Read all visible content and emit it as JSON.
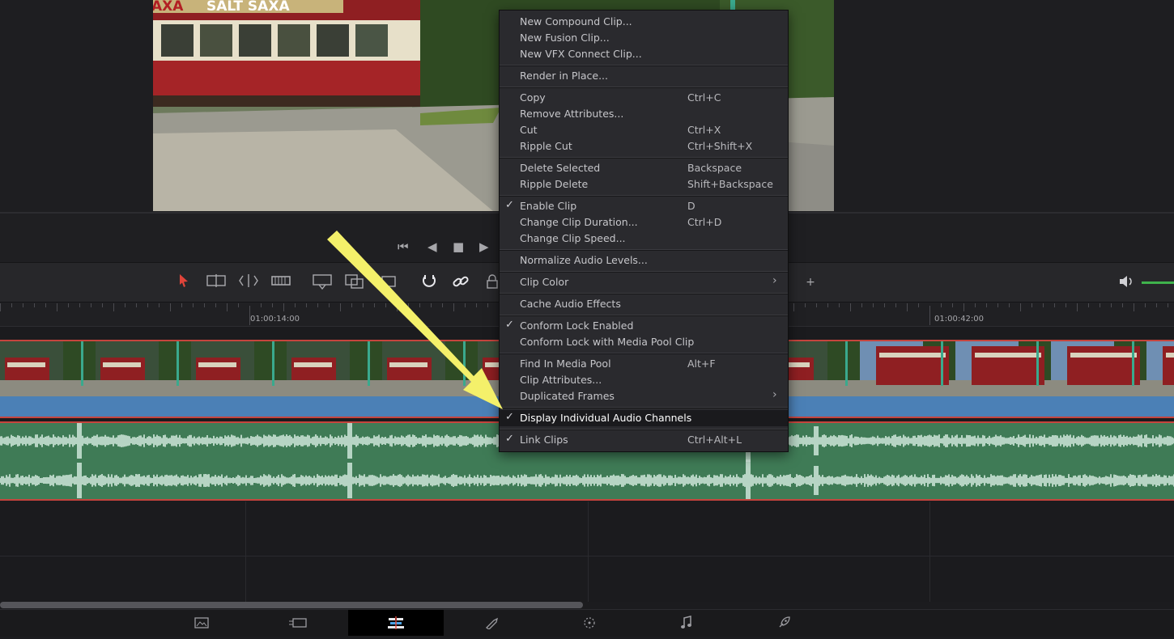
{
  "viewer": {
    "video_sign_text": "SALT SAXA",
    "video_sign_left": "AXA"
  },
  "transport": {
    "icons": [
      "skip-to-start-icon",
      "play-reverse-icon",
      "stop-icon",
      "play-icon"
    ],
    "glyphs": [
      "⏮",
      "◀",
      "■",
      "▶"
    ]
  },
  "ruler": {
    "timecodes": [
      "01:00:14:00",
      "01:00:42:00"
    ]
  },
  "toolbar": {
    "glyph_plus": "+"
  },
  "context_menu": {
    "groups": [
      [
        {
          "label": "New Compound Clip...",
          "shortcut": "",
          "checked": false,
          "submenu": false
        },
        {
          "label": "New Fusion Clip...",
          "shortcut": "",
          "checked": false,
          "submenu": false
        },
        {
          "label": "New VFX Connect Clip...",
          "shortcut": "",
          "checked": false,
          "submenu": false
        }
      ],
      [
        {
          "label": "Render in Place...",
          "shortcut": "",
          "checked": false,
          "submenu": false
        }
      ],
      [
        {
          "label": "Copy",
          "shortcut": "Ctrl+C",
          "checked": false,
          "submenu": false
        },
        {
          "label": "Remove Attributes...",
          "shortcut": "",
          "checked": false,
          "submenu": false
        },
        {
          "label": "Cut",
          "shortcut": "Ctrl+X",
          "checked": false,
          "submenu": false
        },
        {
          "label": "Ripple Cut",
          "shortcut": "Ctrl+Shift+X",
          "checked": false,
          "submenu": false
        }
      ],
      [
        {
          "label": "Delete Selected",
          "shortcut": "Backspace",
          "checked": false,
          "submenu": false
        },
        {
          "label": "Ripple Delete",
          "shortcut": "Shift+Backspace",
          "checked": false,
          "submenu": false
        }
      ],
      [
        {
          "label": "Enable Clip",
          "shortcut": "D",
          "checked": true,
          "submenu": false
        },
        {
          "label": "Change Clip Duration...",
          "shortcut": "Ctrl+D",
          "checked": false,
          "submenu": false
        },
        {
          "label": "Change Clip Speed...",
          "shortcut": "",
          "checked": false,
          "submenu": false
        }
      ],
      [
        {
          "label": "Normalize Audio Levels...",
          "shortcut": "",
          "checked": false,
          "submenu": false
        }
      ],
      [
        {
          "label": "Clip Color",
          "shortcut": "",
          "checked": false,
          "submenu": true
        }
      ],
      [
        {
          "label": "Cache Audio Effects",
          "shortcut": "",
          "checked": false,
          "submenu": false
        }
      ],
      [
        {
          "label": "Conform Lock Enabled",
          "shortcut": "",
          "checked": true,
          "submenu": false
        },
        {
          "label": "Conform Lock with Media Pool Clip",
          "shortcut": "",
          "checked": false,
          "submenu": false
        }
      ],
      [
        {
          "label": "Find In Media Pool",
          "shortcut": "Alt+F",
          "checked": false,
          "submenu": false
        },
        {
          "label": "Clip Attributes...",
          "shortcut": "",
          "checked": false,
          "submenu": false
        },
        {
          "label": "Duplicated Frames",
          "shortcut": "",
          "checked": false,
          "submenu": true
        }
      ],
      [
        {
          "label": "Display Individual Audio Channels",
          "shortcut": "",
          "checked": true,
          "submenu": false,
          "highlighted": true
        }
      ],
      [
        {
          "label": "Link Clips",
          "shortcut": "Ctrl+Alt+L",
          "checked": true,
          "submenu": false
        }
      ]
    ],
    "check_glyph": "✓",
    "submenu_glyph": "›"
  },
  "page_bar": {
    "pages": [
      {
        "name": "media-page",
        "icon": "image-icon",
        "active": false
      },
      {
        "name": "cut-page",
        "icon": "cut-icon",
        "active": false
      },
      {
        "name": "edit-page",
        "icon": "timeline-icon",
        "active": true
      },
      {
        "name": "fusion-page",
        "icon": "fusion-icon",
        "active": false
      },
      {
        "name": "color-page",
        "icon": "color-wheel-icon",
        "active": false
      },
      {
        "name": "fairlight-page",
        "icon": "music-note-icon",
        "active": false
      },
      {
        "name": "deliver-page",
        "icon": "rocket-icon",
        "active": false
      }
    ]
  },
  "colors": {
    "video_clip": "#4b80b6",
    "audio_clip": "#3f7b56",
    "clip_border": "#c6443d",
    "arrow": "#f4f06a",
    "playhead_tool": "#e0443a"
  }
}
